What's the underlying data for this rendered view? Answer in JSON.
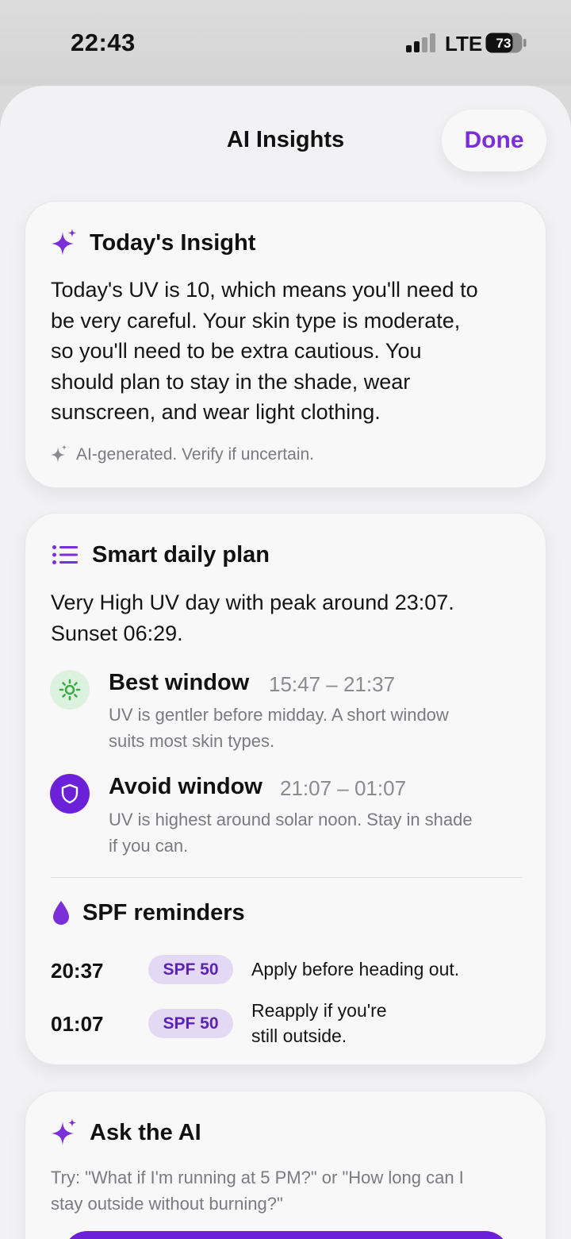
{
  "status_bar": {
    "time": "22:43",
    "network": "LTE",
    "battery": "73"
  },
  "header": {
    "title": "AI Insights",
    "done_label": "Done"
  },
  "insight_card": {
    "title": "Today's Insight",
    "icon": "sparkles-icon",
    "body_lines": [
      "Today's UV is 10, which means you'll need to",
      "be very careful. Your skin type is moderate,",
      "so you'll need to be extra cautious. You",
      "should plan to stay in the shade, wear",
      "sunscreen, and wear light clothing."
    ],
    "disclaimer": "AI-generated. Verify if uncertain."
  },
  "plan_card": {
    "title": "Smart daily plan",
    "icon": "list-icon",
    "summary_lines": [
      "Very High UV day with peak around 23:07.",
      "Sunset 06:29."
    ],
    "best_window": {
      "title": "Best window",
      "time": "15:47 – 21:37",
      "desc_lines": [
        "UV is gentler before midday. A short window",
        "suits most skin types."
      ],
      "icon": "sun-icon"
    },
    "avoid_window": {
      "title": "Avoid window",
      "time": "21:07 – 01:07",
      "desc_lines": [
        "UV is highest around solar noon. Stay in shade",
        "if you can."
      ],
      "icon": "shield-icon"
    },
    "spf": {
      "title": "SPF reminders",
      "icon": "drop-icon",
      "reminders": [
        {
          "time": "20:37",
          "badge": "SPF 50",
          "text_lines": [
            "Apply before heading out."
          ]
        },
        {
          "time": "01:07",
          "badge": "SPF 50",
          "text_lines": [
            "Reapply if you're",
            "still outside."
          ]
        }
      ]
    }
  },
  "ask_card": {
    "title": "Ask the AI",
    "icon": "sparkles-icon",
    "hint_lines": [
      "Try: \"What if I'm running at 5 PM?\" or \"How long can I",
      "stay outside without burning?\""
    ]
  },
  "colors": {
    "accent": "#7b2fd9",
    "badge_bg": "#e4d9f5",
    "best_icon_bg": "#ddf1df",
    "avoid_icon_bg": "#6b21d8"
  }
}
